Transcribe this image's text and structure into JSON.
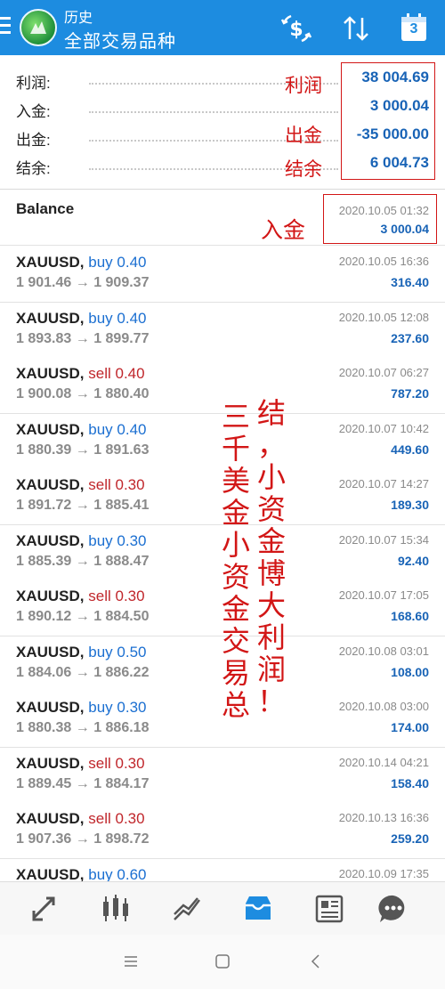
{
  "header": {
    "title": "历史",
    "subtitle": "全部交易品种",
    "calendar_day": "3"
  },
  "summary": {
    "rows": [
      {
        "label": "利润:",
        "value": "38 004.69"
      },
      {
        "label": "入金:",
        "value": "3 000.04"
      },
      {
        "label": "出金:",
        "value": "-35 000.00"
      },
      {
        "label": "结余:",
        "value": "6 004.73"
      }
    ]
  },
  "annotations": {
    "profit": "利润",
    "withdraw": "出金",
    "balance": "结余",
    "deposit": "入金",
    "col1": [
      "三",
      "千",
      "美",
      "金",
      "小",
      "资",
      "金",
      "交",
      "易",
      "总"
    ],
    "col2": [
      "结",
      "，",
      "小",
      "资",
      "金",
      "博",
      "大",
      "利",
      "润",
      "！"
    ]
  },
  "balance_entry": {
    "label": "Balance",
    "time": "2020.10.05 01:32",
    "amount": "3 000.04"
  },
  "deals": [
    {
      "symbol": "XAUUSD,",
      "side": "buy",
      "volume": "0.40",
      "open": "1 901.46",
      "close": "1 909.37",
      "time": "2020.10.05 16:36",
      "profit": "316.40"
    },
    {
      "symbol": "XAUUSD,",
      "side": "buy",
      "volume": "0.40",
      "open": "1 893.83",
      "close": "1 899.77",
      "time": "2020.10.05 12:08",
      "profit": "237.60"
    },
    {
      "symbol": "XAUUSD,",
      "side": "sell",
      "volume": "0.40",
      "open": "1 900.08",
      "close": "1 880.40",
      "time": "2020.10.07 06:27",
      "profit": "787.20"
    },
    {
      "symbol": "XAUUSD,",
      "side": "buy",
      "volume": "0.40",
      "open": "1 880.39",
      "close": "1 891.63",
      "time": "2020.10.07 10:42",
      "profit": "449.60"
    },
    {
      "symbol": "XAUUSD,",
      "side": "sell",
      "volume": "0.30",
      "open": "1 891.72",
      "close": "1 885.41",
      "time": "2020.10.07 14:27",
      "profit": "189.30"
    },
    {
      "symbol": "XAUUSD,",
      "side": "buy",
      "volume": "0.30",
      "open": "1 885.39",
      "close": "1 888.47",
      "time": "2020.10.07 15:34",
      "profit": "92.40"
    },
    {
      "symbol": "XAUUSD,",
      "side": "sell",
      "volume": "0.30",
      "open": "1 890.12",
      "close": "1 884.50",
      "time": "2020.10.07 17:05",
      "profit": "168.60"
    },
    {
      "symbol": "XAUUSD,",
      "side": "buy",
      "volume": "0.50",
      "open": "1 884.06",
      "close": "1 886.22",
      "time": "2020.10.08 03:01",
      "profit": "108.00"
    },
    {
      "symbol": "XAUUSD,",
      "side": "buy",
      "volume": "0.30",
      "open": "1 880.38",
      "close": "1 886.18",
      "time": "2020.10.08 03:00",
      "profit": "174.00"
    },
    {
      "symbol": "XAUUSD,",
      "side": "sell",
      "volume": "0.30",
      "open": "1 889.45",
      "close": "1 884.17",
      "time": "2020.10.14 04:21",
      "profit": "158.40"
    },
    {
      "symbol": "XAUUSD,",
      "side": "sell",
      "volume": "0.30",
      "open": "1 907.36",
      "close": "1 898.72",
      "time": "2020.10.13 16:36",
      "profit": "259.20"
    },
    {
      "symbol": "XAUUSD,",
      "side": "buy",
      "volume": "0.60",
      "open": "",
      "close": "",
      "time": "2020.10.09 17:35",
      "profit": ""
    }
  ],
  "arrow": "→",
  "bottom_nav": [
    "quotes-icon",
    "chart-icon",
    "trade-icon",
    "history-icon",
    "news-icon",
    "chat-icon"
  ],
  "colors": {
    "header": "#1d8ce0",
    "buy": "#1b6fd1",
    "sell": "#c0262b",
    "value": "#1863b6",
    "annotation": "#d21616",
    "active_nav": "#1d8ce0"
  }
}
